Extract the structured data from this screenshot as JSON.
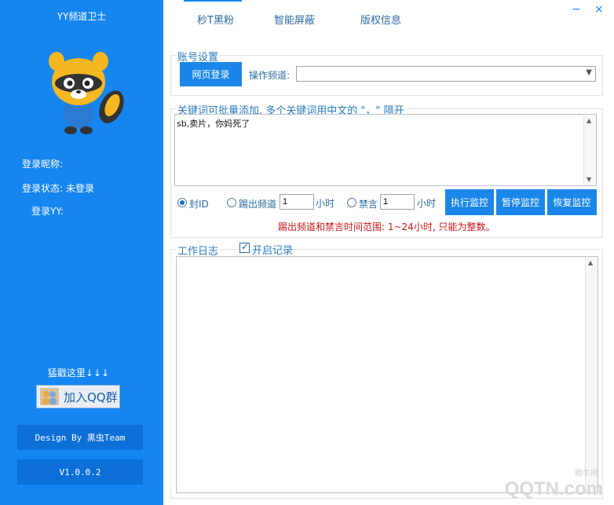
{
  "sidebar": {
    "app_title": "YY频道卫士",
    "login_nickname": "登录昵称:",
    "login_status": "登录状态: 未登录",
    "login_yy": "登录YY:",
    "promo_text": "猛戳这里↓↓↓",
    "qq_button": "加入QQ群",
    "design_by": "Design By 黑虫Team",
    "version": "V1.0.0.2"
  },
  "tabs": [
    {
      "label": "秒T黑粉"
    },
    {
      "label": "智能屏蔽"
    },
    {
      "label": "版权信息"
    }
  ],
  "window": {
    "minimize": "−",
    "close": "×"
  },
  "account": {
    "group_title": "账号设置",
    "web_login_button": "网页登录",
    "channel_label": "操作频道:",
    "channel_value": ""
  },
  "keywords": {
    "group_title": "关键词可批量添加, 多个关键词用中文的 \"，\" 隔开",
    "text": "sb,卖片，你妈死了"
  },
  "actions": {
    "ban_id_label": "封ID",
    "kick_label": "踢出频道",
    "kick_hours": "1",
    "hour_unit": "小时",
    "mute_label": "禁言",
    "mute_hours": "1",
    "mute_hour_unit": "小时",
    "start_button": "执行监控",
    "pause_button": "暂停监控",
    "resume_button": "恢复监控",
    "selected": "ban_id",
    "warning": "踢出频道和禁言时间范围: 1~24小时, 只能为整数。"
  },
  "log": {
    "group_title": "工作日志",
    "enable_label": "开启记录",
    "enable_checked": true
  },
  "watermark": {
    "text": "QQTN.com",
    "small": "腾牛网"
  },
  "colors": {
    "sidebar": "#1585f0",
    "accent": "#1a86ea",
    "warning": "#c81818"
  }
}
